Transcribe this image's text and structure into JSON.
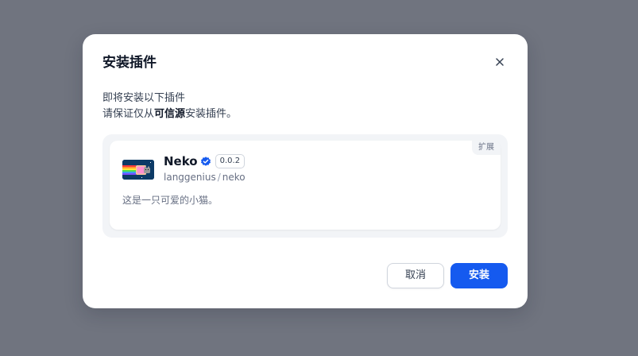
{
  "modal": {
    "title": "安装插件",
    "desc_line1": "即将安装以下插件",
    "desc_line2_before": "请保证仅从",
    "desc_line2_bold": "可信源",
    "desc_line2_after": "安装插件。"
  },
  "plugin": {
    "category_badge": "扩展",
    "name": "Neko",
    "verified": true,
    "version": "0.0.2",
    "org": "langgenius",
    "separator": "/",
    "slug": "neko",
    "description": "这是一只可爱的小猫。",
    "icon": "nyan-cat-icon"
  },
  "buttons": {
    "cancel": "取消",
    "install": "安装"
  },
  "colors": {
    "overlay": "#70747f",
    "primary": "#155aef",
    "verified": "#155aef"
  },
  "icons": {
    "close": "close-icon",
    "verified": "verified-badge-icon"
  }
}
